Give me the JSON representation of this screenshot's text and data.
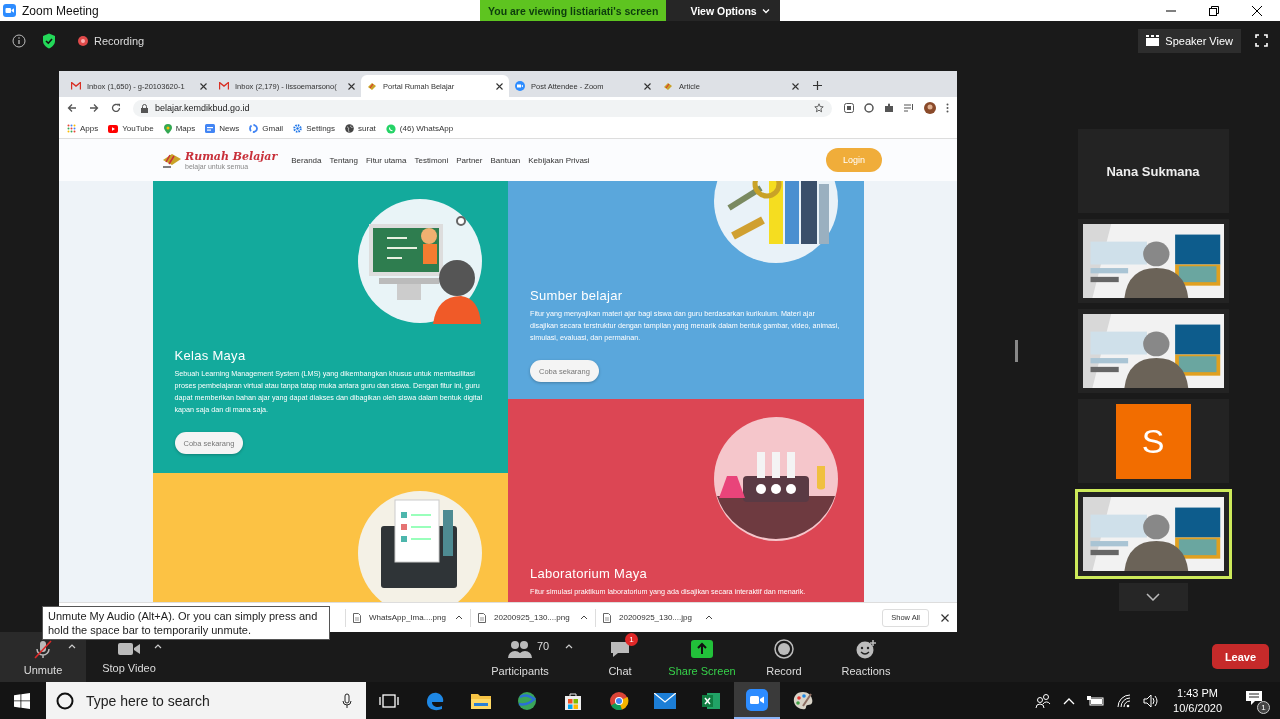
{
  "window": {
    "title": "Zoom Meeting",
    "banner": "You are viewing listiariati's screen",
    "view_options": "View Options"
  },
  "meeting_bar": {
    "recording": "Recording",
    "view_button": "Speaker View"
  },
  "browser": {
    "tabs": [
      {
        "label": "Inbox (1,650) - g-20103620-1",
        "selected": false
      },
      {
        "label": "Inbox (2,179) - lissoemarsono(",
        "selected": false
      },
      {
        "label": "Portal Rumah Belajar",
        "selected": true
      },
      {
        "label": "Post Attendee - Zoom",
        "selected": false
      },
      {
        "label": "Article",
        "selected": false
      }
    ],
    "url": "belajar.kemdikbud.go.id",
    "bookmarks": [
      "Apps",
      "YouTube",
      "Maps",
      "News",
      "Gmail",
      "Settings",
      "surat",
      "(46) WhatsApp"
    ],
    "downloads": [
      "WhatsApp_Ima....png",
      "20200925_130....png",
      "20200925_130....jpg"
    ],
    "show_all": "Show All"
  },
  "site": {
    "logo": "Rumah Belajar",
    "tagline": "belajar untuk semua",
    "nav": [
      "Beranda",
      "Tentang",
      "Fitur utama",
      "Testimoni",
      "Partner",
      "Bantuan",
      "Kebijakan Privasi"
    ],
    "login": "Login",
    "card_columns": [
      {
        "cards": [
          {
            "kind": "feature",
            "color": "#13aa9c",
            "title": "Kelas Maya",
            "text": "Sebuah Learning Management System (LMS) yang dikembangkan khusus untuk memfasilitasi proses pembelajaran virtual atau tanpa tatap muka antara guru dan siswa. Dengan fitur ini, guru dapat memberikan bahan ajar yang dapat diakses dan dibagikan oleh siswa dalam bentuk digital kapan saja dan di mana saja.",
            "button": "Coba sekarang"
          },
          {
            "kind": "art",
            "color": "#fcc244"
          }
        ]
      },
      {
        "cards": [
          {
            "kind": "feature",
            "color": "#5aa7dc",
            "title": "Sumber belajar",
            "text": "Fitur yang menyajikan materi ajar bagi siswa dan guru berdasarkan kurikulum. Materi ajar disajikan secara terstruktur dengan tampilan yang menarik dalam bentuk gambar, video, animasi, simulasi, evaluasi, dan permainan.",
            "button": "Coba sekarang"
          },
          {
            "kind": "feature",
            "color": "#dc4654",
            "title": "Laboratorium Maya",
            "text": "Fitur simulasi praktikum laboratorium yang ada disajikan secara interaktif dan menarik."
          }
        ]
      }
    ]
  },
  "tooltip": "Unmute My Audio (Alt+A). Or you can simply press and hold the space bar to temporarily unmute.",
  "participants": [
    {
      "kind": "name",
      "name": "Nana Sukmana",
      "speaking": false
    },
    {
      "kind": "video",
      "speaking": false
    },
    {
      "kind": "video",
      "speaking": false
    },
    {
      "kind": "avatar",
      "initial": "S",
      "speaking": false
    },
    {
      "kind": "video",
      "speaking": true
    }
  ],
  "toolbar": {
    "left": [
      {
        "label": "Unmute",
        "selected": true
      },
      {
        "label": "Stop Video",
        "selected": false
      }
    ],
    "center": [
      {
        "label": "Participants",
        "count": "70"
      },
      {
        "label": "Chat",
        "badge": "1"
      },
      {
        "label": "Share Screen"
      },
      {
        "label": "Record"
      },
      {
        "label": "Reactions"
      }
    ],
    "leave": "Leave"
  },
  "taskbar": {
    "search_placeholder": "Type here to search",
    "apps": [
      {
        "selected": false
      },
      {
        "selected": false
      },
      {
        "selected": false
      },
      {
        "selected": false
      },
      {
        "selected": false
      },
      {
        "selected": false
      },
      {
        "selected": false
      },
      {
        "selected": false
      },
      {
        "selected": true
      },
      {
        "selected": false
      }
    ],
    "time": "1:43 PM",
    "date": "10/6/2020",
    "notifications": "1"
  }
}
